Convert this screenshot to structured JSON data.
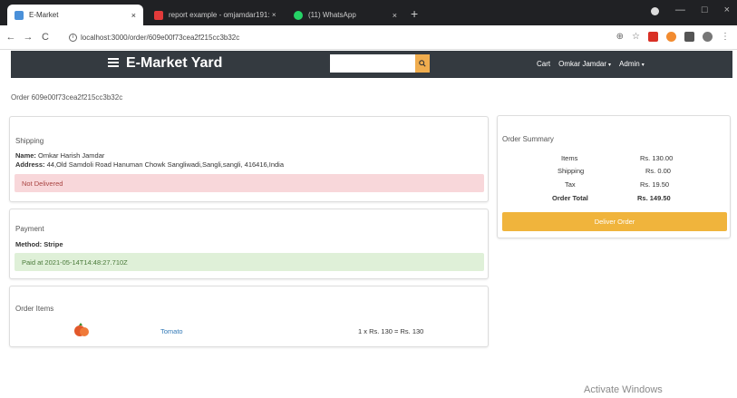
{
  "browser": {
    "tabs": [
      {
        "title": "E-Market",
        "close": "×",
        "favicon_color": "#4a90d9"
      },
      {
        "title": "report example - omjamdar191: ×",
        "close": "",
        "favicon_color": "#e23a3a"
      },
      {
        "title": "(11) WhatsApp",
        "close": "×",
        "favicon_color": "#25d366"
      }
    ],
    "new_tab": "+",
    "window_controls": [
      "—",
      "□",
      "×"
    ],
    "back": "←",
    "forward": "→",
    "reload": "C",
    "url": "localhost:3000/order/609e00f73cea2f215cc3b32c",
    "info_glyph": "i",
    "zoom_glyph": "⊕",
    "star_glyph": "☆",
    "menu_glyph": "⋮"
  },
  "navbar": {
    "brand": "E-Market Yard",
    "search_placeholder": "",
    "search_icon": "search-icon",
    "links": [
      "Cart",
      "Omkar Jamdar",
      "Admin"
    ],
    "caret": "▾",
    "background": "#343a40",
    "accent": "#f0ad4e"
  },
  "order": {
    "id_text": "Order 609e00f73cea2f215cc3b32c"
  },
  "shipping": {
    "title": "Shipping",
    "name_label": "Name:",
    "name": "Omkar Harish Jamdar",
    "address_label": "Address:",
    "address": "44,Old Samdoli Road Hanuman Chowk Sangliwadi,Sangli,sangli, 416416,India",
    "status": "Not Delivered"
  },
  "payment": {
    "title": "Payment",
    "method_label": "Method:",
    "method": "Stripe",
    "status": "Paid at 2021-05-14T14:48:27.710Z"
  },
  "order_items": {
    "title": "Order Items",
    "items": [
      {
        "name": "Tomato",
        "calc": "1 x Rs. 130 = Rs. 130"
      }
    ]
  },
  "summary": {
    "title": "Order Summary",
    "rows": [
      {
        "label": "Items",
        "value": "Rs. 130.00"
      },
      {
        "label": "Shipping",
        "value": "Rs. 0.00"
      },
      {
        "label": "Tax",
        "value": "Rs. 19.50"
      },
      {
        "label": "Order Total",
        "value": "Rs. 149.50"
      }
    ],
    "button": "Deliver Order"
  },
  "watermark": "Activate Windows"
}
